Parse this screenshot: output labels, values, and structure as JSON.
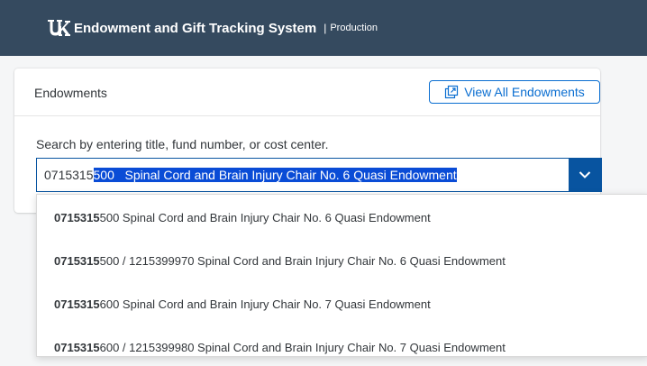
{
  "header": {
    "logo_icon": "uk-logo-icon",
    "title": "Endowment and Gift Tracking System",
    "separator": "|",
    "environment": "Production",
    "bg_color": "#354a5f"
  },
  "card": {
    "title": "Endowments",
    "view_all_label": "View All Endowments",
    "view_all_icon": "open-external-icon",
    "search_label": "Search by entering title, fund number, or cost center."
  },
  "search": {
    "typed": "0715315",
    "autocomplete": "500   Spinal Cord and Brain Injury Chair No. 6 Quasi Endowment",
    "dropdown_icon": "chevron-down-icon",
    "accent_color": "#0854a0"
  },
  "suggestions": [
    {
      "match": "0715315",
      "rest": "500 Spinal Cord and Brain Injury Chair No. 6 Quasi Endowment"
    },
    {
      "match": "0715315",
      "rest": "500 / 1215399970 Spinal Cord and Brain Injury Chair No. 6 Quasi Endowment"
    },
    {
      "match": "0715315",
      "rest": "600 Spinal Cord and Brain Injury Chair No. 7 Quasi Endowment"
    },
    {
      "match": "0715315",
      "rest": "600 / 1215399980 Spinal Cord and Brain Injury Chair No. 7 Quasi Endowment"
    }
  ]
}
